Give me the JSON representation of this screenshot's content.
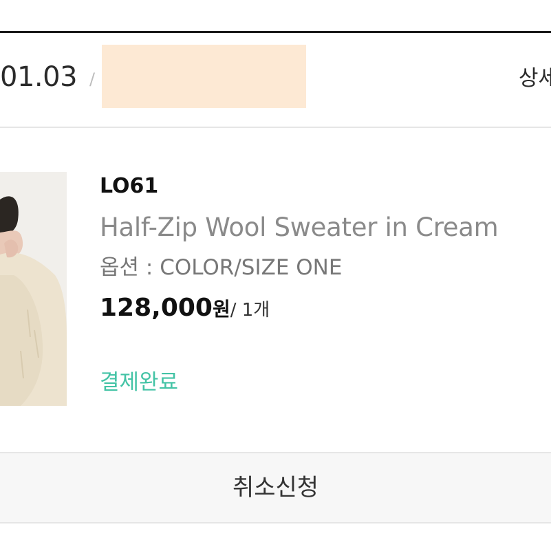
{
  "order": {
    "date": "01.03",
    "separator": "/",
    "detail_label": "상세"
  },
  "product": {
    "brand": "LO61",
    "name": "Half-Zip Wool Sweater in Cream",
    "option_label": "옵션 : COLOR/SIZE ONE",
    "price": "128,000",
    "currency": "원",
    "quantity": "/ 1개",
    "status": "결제완료",
    "status_color": "#43c3a5"
  },
  "actions": {
    "cancel_label": "취소신청"
  }
}
